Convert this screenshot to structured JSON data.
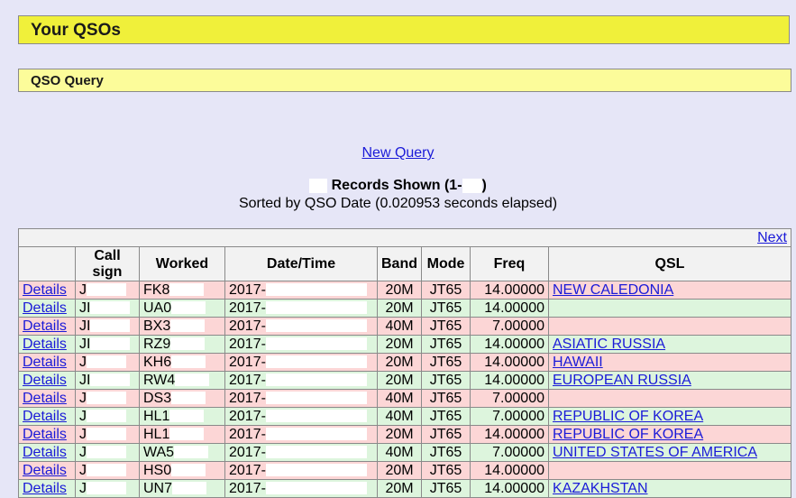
{
  "page": {
    "title": "Your QSOs",
    "query_label": "QSO Query",
    "new_query": "New Query",
    "records_prefix": "Records Shown (1-",
    "records_suffix": ")",
    "sorted_text": "Sorted by QSO Date (0.020953 seconds elapsed)"
  },
  "table": {
    "next_label": "Next",
    "headers": {
      "details": "",
      "callsign_line1": "Call",
      "callsign_line2": "sign",
      "worked": "Worked",
      "datetime": "Date/Time",
      "band": "Band",
      "mode": "Mode",
      "freq": "Freq",
      "qsl": "QSL"
    },
    "rows": [
      {
        "details": "Details",
        "call": "J",
        "worked": "FK8",
        "datetime": "2017-",
        "band": "20M",
        "mode": "JT65",
        "freq": "14.00000",
        "qsl": "NEW CALEDONIA"
      },
      {
        "details": "Details",
        "call": "JI",
        "worked": "UA0",
        "datetime": "2017-",
        "band": "20M",
        "mode": "JT65",
        "freq": "14.00000",
        "qsl": ""
      },
      {
        "details": "Details",
        "call": "JI",
        "worked": "BX3",
        "datetime": "2017-",
        "band": "40M",
        "mode": "JT65",
        "freq": "7.00000",
        "qsl": ""
      },
      {
        "details": "Details",
        "call": "JI",
        "worked": "RZ9",
        "datetime": "2017-",
        "band": "20M",
        "mode": "JT65",
        "freq": "14.00000",
        "qsl": "ASIATIC RUSSIA"
      },
      {
        "details": "Details",
        "call": "J",
        "worked": "KH6",
        "datetime": "2017-",
        "band": "20M",
        "mode": "JT65",
        "freq": "14.00000",
        "qsl": "HAWAII"
      },
      {
        "details": "Details",
        "call": "JI",
        "worked": "RW4",
        "datetime": "2017-",
        "band": "20M",
        "mode": "JT65",
        "freq": "14.00000",
        "qsl": "EUROPEAN RUSSIA"
      },
      {
        "details": "Details",
        "call": "J",
        "worked": "DS3",
        "datetime": "2017-",
        "band": "40M",
        "mode": "JT65",
        "freq": "7.00000",
        "qsl": ""
      },
      {
        "details": "Details",
        "call": "J",
        "worked": "HL1",
        "datetime": "2017-",
        "band": "40M",
        "mode": "JT65",
        "freq": "7.00000",
        "qsl": "REPUBLIC OF KOREA"
      },
      {
        "details": "Details",
        "call": "J",
        "worked": "HL1",
        "datetime": "2017-",
        "band": "20M",
        "mode": "JT65",
        "freq": "14.00000",
        "qsl": "REPUBLIC OF KOREA"
      },
      {
        "details": "Details",
        "call": "J",
        "worked": "WA5",
        "datetime": "2017-",
        "band": "40M",
        "mode": "JT65",
        "freq": "7.00000",
        "qsl": "UNITED STATES OF AMERICA"
      },
      {
        "details": "Details",
        "call": "J",
        "worked": "HS0",
        "datetime": "2017-",
        "band": "20M",
        "mode": "JT65",
        "freq": "14.00000",
        "qsl": ""
      },
      {
        "details": "Details",
        "call": "J",
        "worked": "UN7",
        "datetime": "2017-",
        "band": "20M",
        "mode": "JT65",
        "freq": "14.00000",
        "qsl": "KAZAKHSTAN"
      }
    ]
  },
  "colors": {
    "page_bg": "#e6e6f7",
    "title_bg": "#f0f03a",
    "query_bg": "#fcfc9a",
    "row_pink": "#fcd6d6",
    "row_green": "#ddf5dd",
    "link": "#1a1ad8"
  }
}
